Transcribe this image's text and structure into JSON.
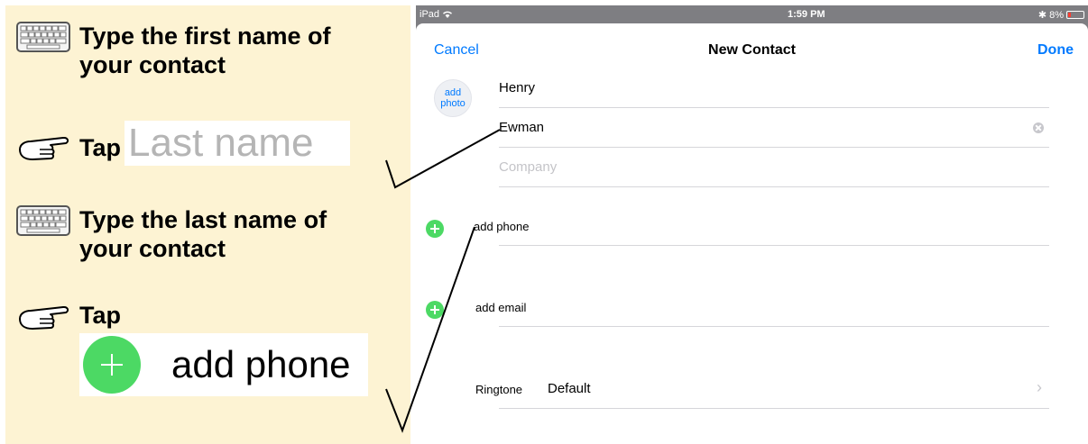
{
  "instructions": {
    "step1": "Type the first name of your contact",
    "step2_tap": "Tap",
    "step2_target": "Last name",
    "step3": "Type the last name of your contact",
    "step4_tap": "Tap",
    "step4_target": "add phone"
  },
  "status_bar": {
    "device": "iPad",
    "time": "1:59 PM",
    "battery": "8%"
  },
  "nav": {
    "cancel": "Cancel",
    "title": "New Contact",
    "done": "Done"
  },
  "avatar": {
    "line1": "add",
    "line2": "photo"
  },
  "form": {
    "first_name": "Henry",
    "last_name": "Ewman",
    "company_placeholder": "Company",
    "add_phone": "add phone",
    "add_email": "add email",
    "ringtone_label": "Ringtone",
    "ringtone_value": "Default"
  },
  "colors": {
    "panel": "#fdf3d3",
    "ios_blue": "#007aff",
    "ios_green": "#4cd964"
  },
  "icons": {
    "keyboard": "keyboard-icon",
    "hand": "pointing-hand-icon",
    "wifi": "wifi-icon",
    "bluetooth": "bluetooth-icon",
    "battery": "battery-icon"
  }
}
